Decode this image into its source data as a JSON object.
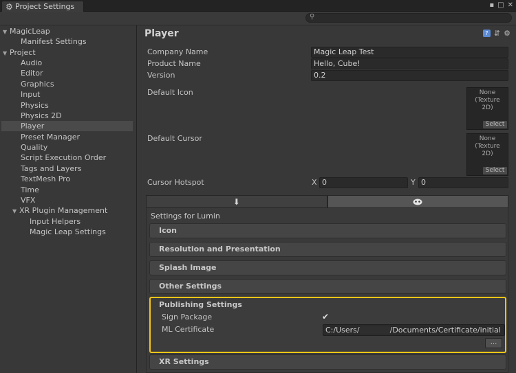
{
  "window": {
    "title": "Project Settings",
    "controls": [
      "▪",
      "□",
      "✕"
    ]
  },
  "sidebar": {
    "items": [
      {
        "label": "MagicLeap",
        "arrow": "▼"
      },
      {
        "label": "Manifest Settings"
      },
      {
        "label": "Project",
        "arrow": "▼"
      },
      {
        "label": "Audio"
      },
      {
        "label": "Editor"
      },
      {
        "label": "Graphics"
      },
      {
        "label": "Input"
      },
      {
        "label": "Physics"
      },
      {
        "label": "Physics 2D"
      },
      {
        "label": "Player",
        "selected": true
      },
      {
        "label": "Preset Manager"
      },
      {
        "label": "Quality"
      },
      {
        "label": "Script Execution Order"
      },
      {
        "label": "Tags and Layers"
      },
      {
        "label": "TextMesh Pro"
      },
      {
        "label": "Time"
      },
      {
        "label": "VFX"
      },
      {
        "label": "XR Plugin Management",
        "arrow": "▼"
      },
      {
        "label": "Input Helpers"
      },
      {
        "label": "Magic Leap Settings"
      }
    ]
  },
  "main": {
    "title": "Player",
    "company_name_label": "Company Name",
    "company_name_value": "Magic Leap Test",
    "product_name_label": "Product Name",
    "product_name_value": "Hello, Cube!",
    "version_label": "Version",
    "version_value": "0.2",
    "default_icon_label": "Default Icon",
    "default_cursor_label": "Default Cursor",
    "texture_placeholder": "None\n(Texture\n2D)",
    "select_label": "Select",
    "cursor_hotspot_label": "Cursor Hotspot",
    "hotspot_x_label": "X",
    "hotspot_x_value": "0",
    "hotspot_y_label": "Y",
    "hotspot_y_value": "0"
  },
  "platform": {
    "tabs": [
      {
        "icon": "download-icon",
        "glyph": "⬇"
      },
      {
        "icon": "magic-leap-icon",
        "active": true
      }
    ],
    "settings_for": "Settings for Lumin",
    "sections": {
      "icon": "Icon",
      "resolution": "Resolution and Presentation",
      "splash": "Splash Image",
      "other": "Other Settings",
      "publishing": "Publishing Settings",
      "xr": "XR Settings"
    },
    "publishing": {
      "sign_package_label": "Sign Package",
      "sign_package_checked": true,
      "ml_certificate_label": "ML Certificate",
      "ml_certificate_prefix": "C:/Users/",
      "ml_certificate_suffix": "/Documents/Certificate/initial",
      "browse_button": "..."
    }
  },
  "colors": {
    "highlight": "#f5c518",
    "background": "#383838",
    "field": "#2a2a2a",
    "selected": "#4a4a4a"
  }
}
